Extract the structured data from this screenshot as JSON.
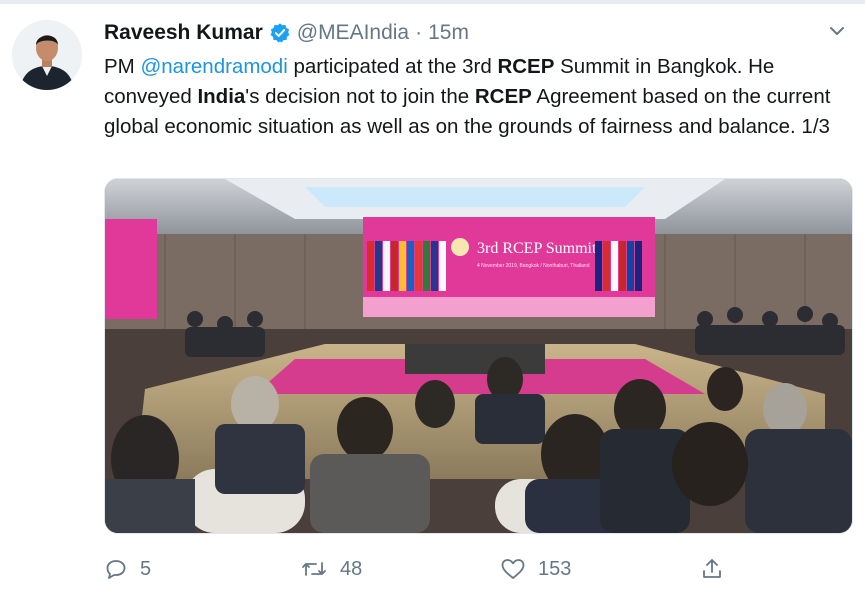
{
  "author": {
    "name": "Raveesh Kumar",
    "handle": "@MEAIndia",
    "separator": "·",
    "time": "15m"
  },
  "tweet": {
    "parts": [
      {
        "t": "PM "
      },
      {
        "t": "@narendramodi",
        "k": "mention"
      },
      {
        "t": " participated at the 3rd "
      },
      {
        "t": "RCEP",
        "k": "bold"
      },
      {
        "t": " Summit in Bangkok. He conveyed "
      },
      {
        "t": "India",
        "k": "bold"
      },
      {
        "t": "'s decision not to join the "
      },
      {
        "t": "RCEP",
        "k": "bold"
      },
      {
        "t": " Agreement based on the current global economic situation as well as on the grounds of fairness and balance. 1/3"
      }
    ]
  },
  "media": {
    "banner_title": "3rd RCEP Summit",
    "banner_subtitle": "4 November 2019, Bangkok / Nonthaburi, Thailand"
  },
  "actions": {
    "reply_count": "5",
    "retweet_count": "48",
    "like_count": "153"
  },
  "colors": {
    "accent": "#1b95e0",
    "verified": "#1da1f2",
    "muted": "#657786",
    "banner": "#e0399a"
  }
}
